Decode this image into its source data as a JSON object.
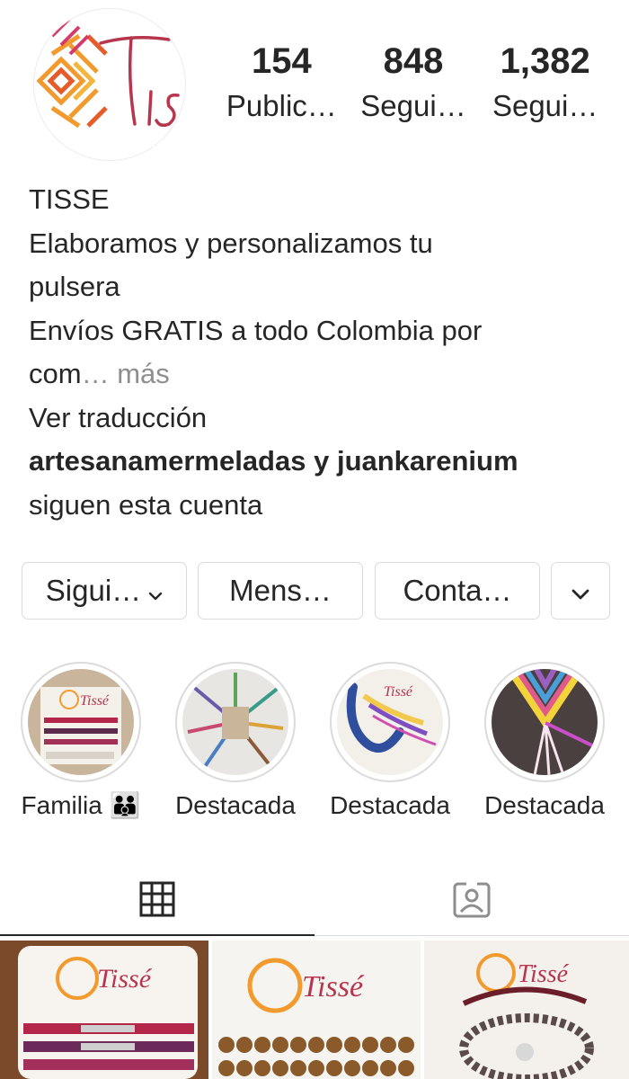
{
  "profile": {
    "stats": [
      {
        "value": "154",
        "label": "Public…"
      },
      {
        "value": "848",
        "label": "Segui…"
      },
      {
        "value": "1,382",
        "label": "Segui…"
      }
    ]
  },
  "bio": {
    "name": "TISSE",
    "line1": "Elaboramos y personalizamos tu",
    "line2": "pulsera",
    "line3": "Envíos GRATIS a todo Colombia por",
    "line4_text": "com",
    "line4_ellipsis": "…",
    "line4_more": " más",
    "translate": "Ver traducción",
    "followed_by_user1": "artesanamermeladas",
    "followed_by_and": " y ",
    "followed_by_user2": "juankarenium",
    "followed_by_suffix": "siguen esta cuenta"
  },
  "buttons": {
    "follow": "Sigui…",
    "message": "Mens…",
    "contact": "Conta…"
  },
  "highlights": [
    {
      "label": "Familia 👪"
    },
    {
      "label": "Destacada"
    },
    {
      "label": "Destacada"
    },
    {
      "label": "Destacada"
    }
  ],
  "tabs": {
    "grid": "grid-icon",
    "tagged": "tagged-icon"
  },
  "colors": {
    "text": "#262626",
    "muted": "#8e8e8e",
    "border": "#dbdbdb",
    "brand": "#b5364d",
    "brand_orange": "#f28c1e"
  }
}
